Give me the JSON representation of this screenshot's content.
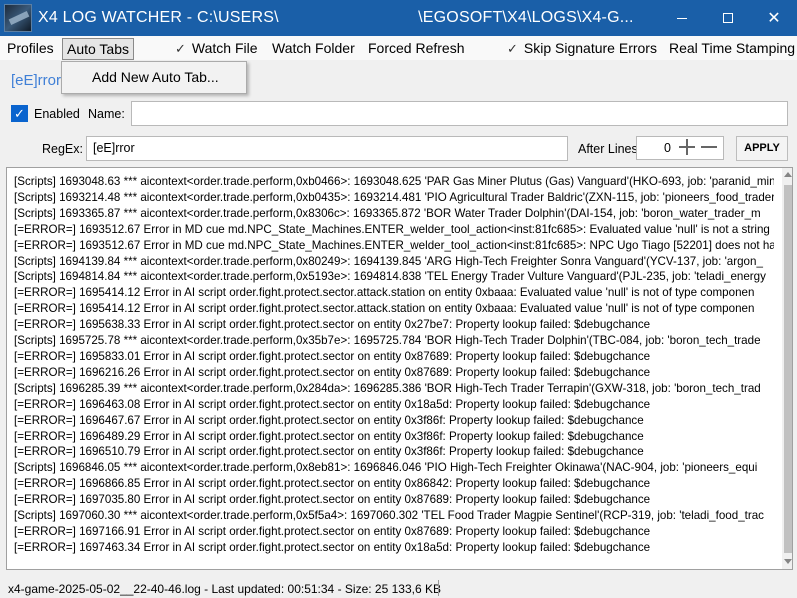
{
  "window": {
    "title": "X4 LOG WATCHER - C:\\USERS\\                              \\EGOSOFT\\X4\\LOGS\\X4-G..."
  },
  "menu": {
    "profiles": "Profiles",
    "auto_tabs": "Auto Tabs",
    "watch_file": "Watch File",
    "watch_folder": "Watch Folder",
    "forced_refresh": "Forced Refresh",
    "skip_signature_errors": "Skip Signature Errors",
    "real_time_stamping": "Real Time Stamping",
    "check_mark": "✓"
  },
  "auto_tabs_menu": {
    "add_new": "Add New Auto Tab..."
  },
  "tab": {
    "title": "[eE]rror"
  },
  "form": {
    "enabled_label": "Enabled",
    "enabled_checked": true,
    "name_label": "Name:",
    "name_value": "",
    "regex_label": "RegEx:",
    "regex_value": "[eE]rror",
    "after_lines_label": "After Lines:",
    "after_lines_value": "0",
    "apply_label": "APPLY"
  },
  "log": {
    "lines": [
      "[Scripts] 1693048.63 *** aicontext<order.trade.perform,0xb0466>: 1693048.625 'PAR Gas Miner Plutus (Gas) Vanguard'(HKO-693, job: 'paranid_miner_gas_m",
      "[Scripts] 1693214.48 *** aicontext<order.trade.perform,0xb0435>: 1693214.481 'PIO Agricultural Trader Baldric'(ZXN-115, job: 'pioneers_food_trader_s",
      "[Scripts] 1693365.87 *** aicontext<order.trade.perform,0x8306c>: 1693365.872 'BOR Water Trader Dolphin'(DAI-154, job: 'boron_water_trader_m",
      "[=ERROR=] 1693512.67 Error in MD cue md.NPC_State_Machines.ENTER_welder_tool_action<inst:81fc685>: Evaluated value 'null' is not a string",
      "[=ERROR=] 1693512.67 Error in MD cue md.NPC_State_Machines.ENTER_welder_tool_action<inst:81fc685>: NPC Ugo Tiago [52201] does not ha",
      "[Scripts] 1694139.84 *** aicontext<order.trade.perform,0x80249>: 1694139.845 'ARG High-Tech Freighter Sonra Vanguard'(YCV-137, job: 'argon_",
      "[Scripts] 1694814.84 *** aicontext<order.trade.perform,0x5193e>: 1694814.838 'TEL Energy Trader Vulture Vanguard'(PJL-235, job: 'teladi_energy",
      "[=ERROR=] 1695414.12 Error in AI script order.fight.protect.sector.attack.station on entity 0xbaaa: Evaluated value 'null' is not of type componen",
      "[=ERROR=] 1695414.12 Error in AI script order.fight.protect.sector.attack.station on entity 0xbaaa: Evaluated value 'null' is not of type componen",
      "[=ERROR=] 1695638.33 Error in AI script order.fight.protect.sector on entity 0x27be7: Property lookup failed: $debugchance",
      "[Scripts] 1695725.78 *** aicontext<order.trade.perform,0x35b7e>: 1695725.784 'BOR High-Tech Trader Dolphin'(TBC-084, job: 'boron_tech_trade",
      "[=ERROR=] 1695833.01 Error in AI script order.fight.protect.sector on entity 0x87689: Property lookup failed: $debugchance",
      "[=ERROR=] 1696216.26 Error in AI script order.fight.protect.sector on entity 0x87689: Property lookup failed: $debugchance",
      "[Scripts] 1696285.39 *** aicontext<order.trade.perform,0x284da>: 1696285.386 'BOR High-Tech Trader Terrapin'(GXW-318, job: 'boron_tech_trad",
      "[=ERROR=] 1696463.08 Error in AI script order.fight.protect.sector on entity 0x18a5d: Property lookup failed: $debugchance",
      "[=ERROR=] 1696467.67 Error in AI script order.fight.protect.sector on entity 0x3f86f: Property lookup failed: $debugchance",
      "[=ERROR=] 1696489.29 Error in AI script order.fight.protect.sector on entity 0x3f86f: Property lookup failed: $debugchance",
      "[=ERROR=] 1696510.79 Error in AI script order.fight.protect.sector on entity 0x3f86f: Property lookup failed: $debugchance",
      "[Scripts] 1696846.05 *** aicontext<order.trade.perform,0x8eb81>: 1696846.046 'PIO High-Tech Freighter Okinawa'(NAC-904, job: 'pioneers_equi",
      "[=ERROR=] 1696866.85 Error in AI script order.fight.protect.sector on entity 0x86842: Property lookup failed: $debugchance",
      "[=ERROR=] 1697035.80 Error in AI script order.fight.protect.sector on entity 0x87689: Property lookup failed: $debugchance",
      "[Scripts] 1697060.30 *** aicontext<order.trade.perform,0x5f5a4>: 1697060.302 'TEL Food Trader Magpie Sentinel'(RCP-319, job: 'teladi_food_trac",
      "[=ERROR=] 1697166.91 Error in AI script order.fight.protect.sector on entity 0x87689: Property lookup failed: $debugchance",
      "[=ERROR=] 1697463.34 Error in AI script order.fight.protect.sector on entity 0x18a5d: Property lookup failed: $debugchance"
    ]
  },
  "status": {
    "text": "x4-game-2025-05-02__22-40-46.log - Last updated: 00:51:34 - Size: 25 133,6 KB"
  },
  "colors": {
    "titlebar": "#1a5fa8",
    "accent": "#3f7fd6",
    "checkbox": "#0a64ce"
  }
}
